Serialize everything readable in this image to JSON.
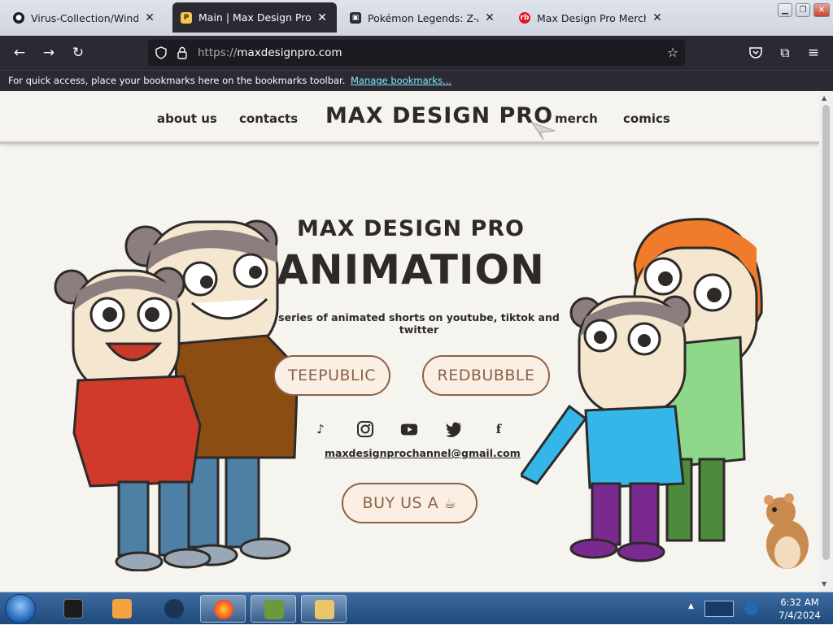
{
  "browser": {
    "tabs": [
      {
        "label": "Virus-Collection/Windows/E",
        "favicon": "github-icon",
        "active": false
      },
      {
        "label": "Main | Max Design Pro Ani",
        "favicon": "site-icon",
        "active": true
      },
      {
        "label": "Pokémon Legends: Z-A Feat",
        "favicon": "page-icon",
        "active": false
      },
      {
        "label": "Max Design Pro Merch Shop",
        "favicon": "redbubble-icon",
        "active": false
      }
    ],
    "url_proto": "https://",
    "url_host": "maxdesignpro.com",
    "bookmarks_message": "For quick access, place your bookmarks here on the bookmarks toolbar.",
    "bookmarks_link": "Manage bookmarks..."
  },
  "site": {
    "nav": {
      "about": "about us",
      "contacts": "contacts",
      "logo": "MAX DESIGN PRO",
      "merch": "merch",
      "comics": "comics"
    },
    "hero": {
      "subtitle": "MAX DESIGN PRO",
      "title": "ANIMATION",
      "tagline": "series of animated shorts on youtube, tiktok and twitter"
    },
    "buttons": {
      "teepublic": "TEEPUBLIC",
      "redbubble": "REDBUBBLE",
      "buy": "BUY US A"
    },
    "social": [
      "tiktok-icon",
      "instagram-icon",
      "youtube-icon",
      "twitter-icon",
      "facebook-icon"
    ],
    "email": "maxdesignprochannel@gmail.com"
  },
  "taskbar": {
    "time": "6:32 AM",
    "date": "7/4/2024",
    "items": [
      "terminal",
      "media-player",
      "generic-app",
      "firefox",
      "box-game",
      "file-explorer"
    ]
  },
  "colors": {
    "accent_brown": "#8a6247",
    "page_bg": "#f6f4ef",
    "text_dark": "#2d2a28",
    "browser_dark": "#2b2a33"
  }
}
